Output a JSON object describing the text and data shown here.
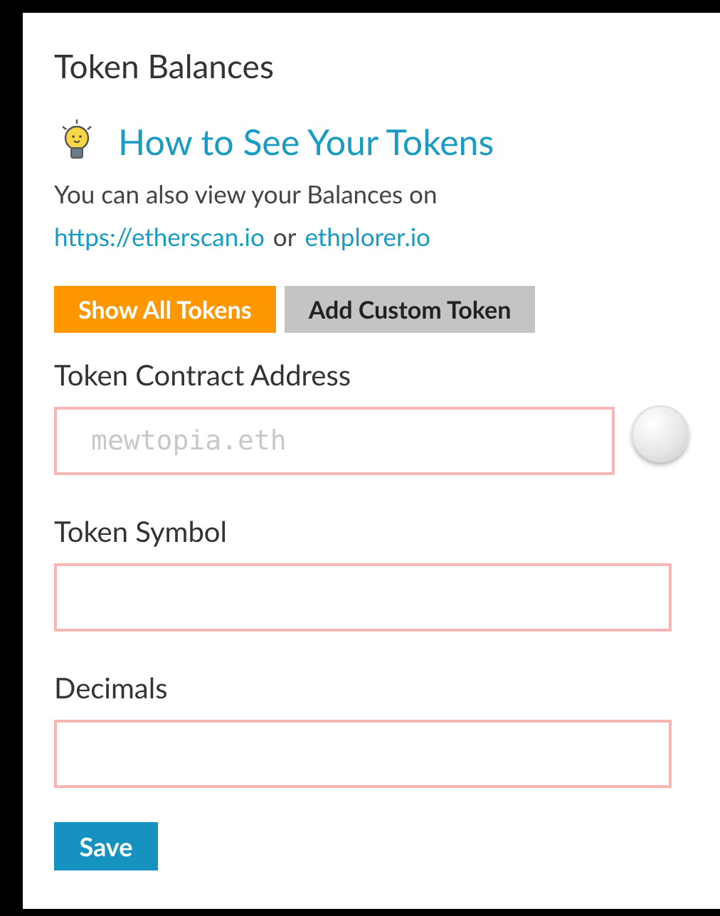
{
  "title": "Token Balances",
  "help": {
    "heading": "How to See Your Tokens",
    "text": "You can also view your Balances on",
    "links": [
      "https://etherscan.io",
      "ethplorer.io"
    ],
    "joiner": "or"
  },
  "buttons": [
    {
      "label": "Show All Tokens",
      "kind": "primary"
    },
    {
      "label": "Add Custom Token",
      "kind": "secondary"
    }
  ],
  "fields": [
    {
      "label": "Token Contract Address",
      "placeholder": "mewtopia.eth",
      "invalid": true,
      "kind": "address"
    },
    {
      "label": "Token Symbol",
      "invalid": true,
      "kind": "text"
    },
    {
      "label": "Decimals",
      "invalid": true,
      "kind": "text"
    }
  ],
  "save": "Save"
}
